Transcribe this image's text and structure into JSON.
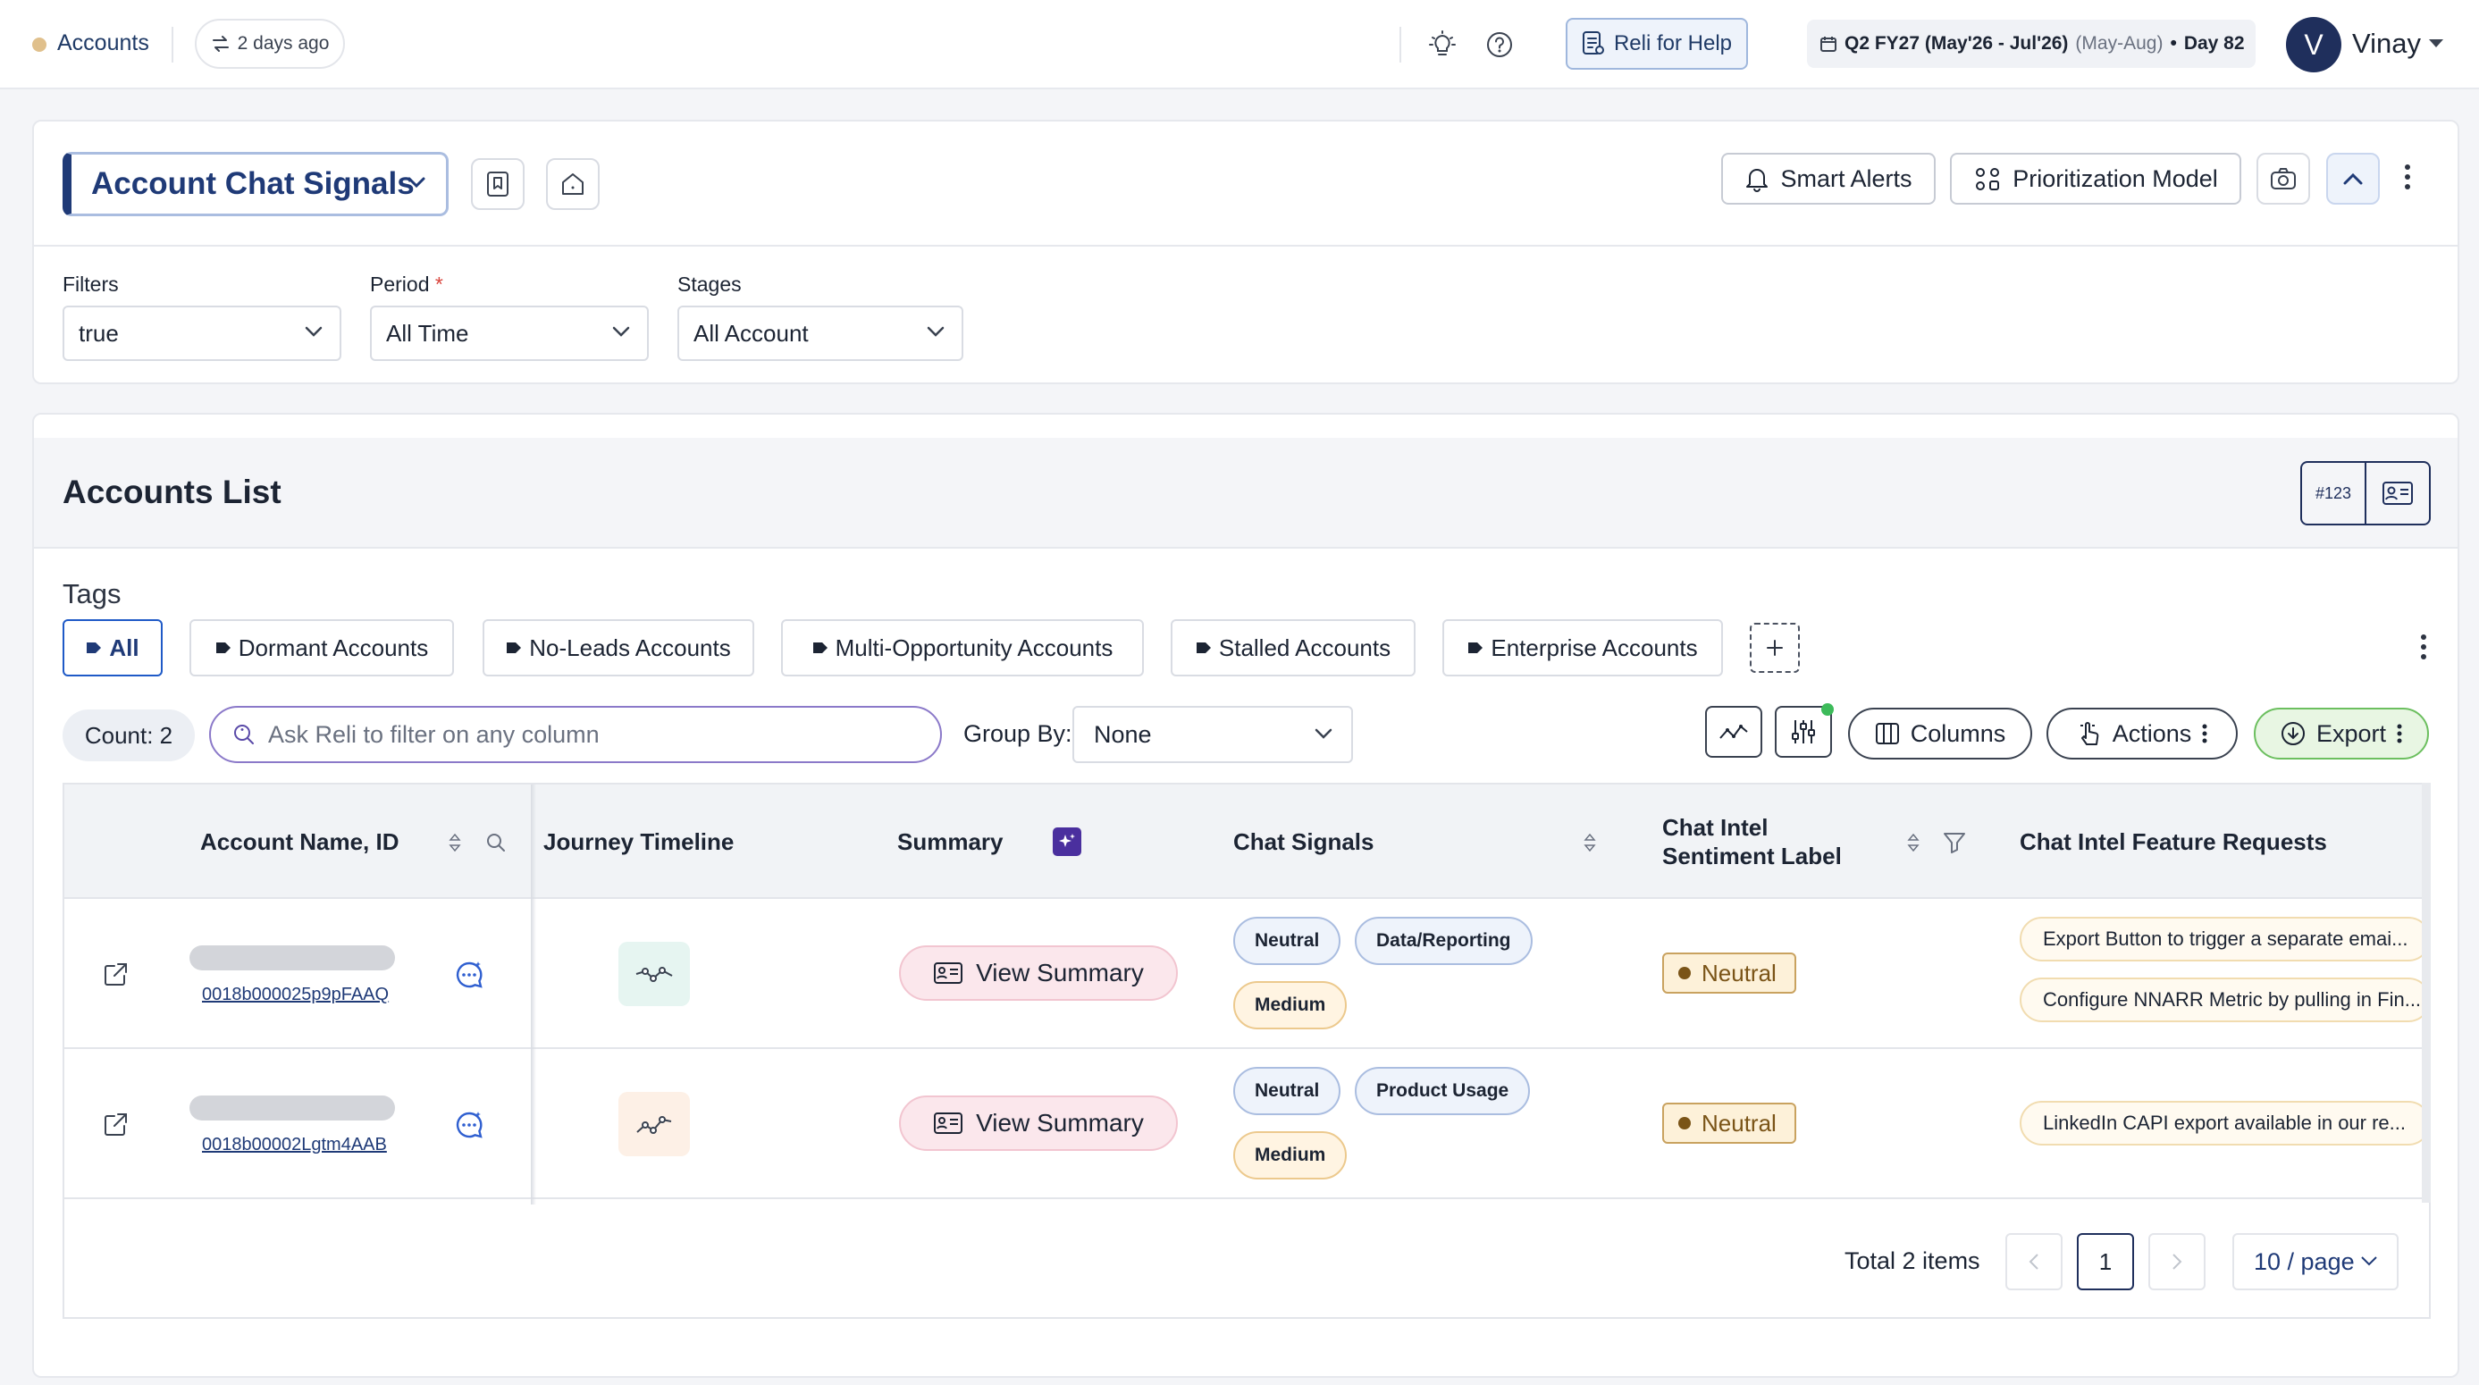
{
  "topbar": {
    "breadcrumb": "Accounts",
    "sync_label": "2 days ago",
    "help_button": "Reli for Help",
    "quarter": {
      "main": "Q2 FY27 (May'26 - Jul'26)",
      "range": "(May-Aug)",
      "separator": "•",
      "day": "Day 82"
    },
    "user": {
      "initial": "V",
      "name": "Vinay"
    }
  },
  "dashboard": {
    "title": "Account Chat Signals",
    "buttons": {
      "smart_alerts": "Smart Alerts",
      "prioritization": "Prioritization Model"
    }
  },
  "filters": {
    "filters_label": "Filters",
    "filters_value": "true",
    "period_label": "Period",
    "period_required": "*",
    "period_value": "All Time",
    "stages_label": "Stages",
    "stages_value": "All Account"
  },
  "list": {
    "title": "Accounts List",
    "view_toggle": {
      "number_view": "#123"
    },
    "tags_label": "Tags",
    "tags": [
      {
        "label": "All",
        "active": true
      },
      {
        "label": "Dormant Accounts"
      },
      {
        "label": "No-Leads Accounts"
      },
      {
        "label": "Multi-Opportunity Accounts"
      },
      {
        "label": "Stalled Accounts"
      },
      {
        "label": "Enterprise Accounts"
      }
    ],
    "count_label": "Count: 2",
    "search_placeholder": "Ask Reli to filter on any column",
    "group_by_label": "Group By:",
    "group_by_value": "None",
    "columns_button": "Columns",
    "actions_button": "Actions",
    "export_button": "Export"
  },
  "table": {
    "headers": {
      "account": "Account Name, ID",
      "journey": "Journey Timeline",
      "summary": "Summary",
      "signals": "Chat Signals",
      "sentiment_line1": "Chat Intel",
      "sentiment_line2": "Sentiment Label",
      "features": "Chat Intel Feature Requests"
    },
    "rows": [
      {
        "account_id": "0018b000025p9pFAAQ",
        "summary_button": "View Summary",
        "signals": [
          "Neutral",
          "Data/Reporting",
          "Medium"
        ],
        "sentiment": "Neutral",
        "features": [
          "Export Button to trigger a separate emai...",
          "Configure NNARR Metric by pulling in Fin..."
        ]
      },
      {
        "account_id": "0018b00002Lgtm4AAB",
        "summary_button": "View Summary",
        "signals": [
          "Neutral",
          "Product Usage",
          "Medium"
        ],
        "sentiment": "Neutral",
        "features": [
          "LinkedIn CAPI export available in our re..."
        ]
      }
    ]
  },
  "pagination": {
    "total": "Total 2 items",
    "current_page": "1",
    "page_size": "10 / page"
  },
  "colors": {
    "brand_navy": "#1f2f5c",
    "accent_blue": "#1f3a77",
    "export_green": "#6cbf5f",
    "neutral_amber": "#7a5417"
  }
}
